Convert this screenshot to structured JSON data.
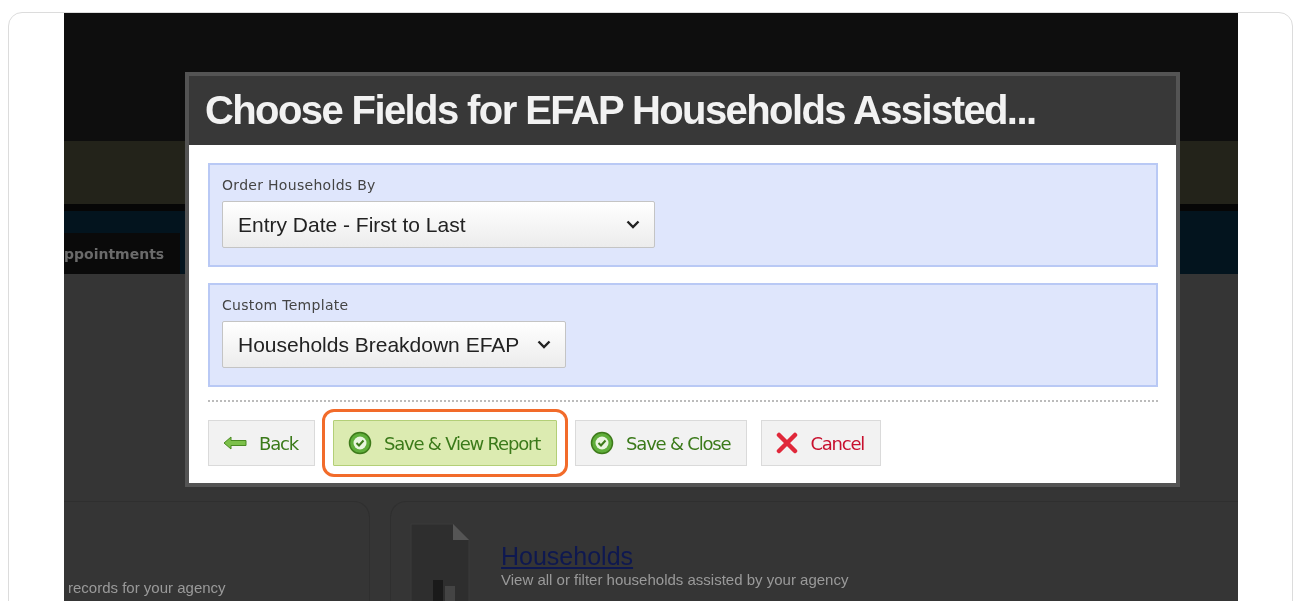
{
  "backdrop": {
    "nav_tab": "ppointments",
    "cards": [
      {
        "description": "records for your agency"
      },
      {
        "title": "Households",
        "description": "View all or filter households assisted by your agency"
      }
    ]
  },
  "dialog": {
    "title": "Choose Fields for EFAP Households Assisted...",
    "fields": [
      {
        "label": "Order Households By",
        "value": "Entry Date - First to Last"
      },
      {
        "label": "Custom Template",
        "value": "Households Breakdown EFAP"
      }
    ],
    "buttons": [
      {
        "label": "Back",
        "kind": "back",
        "highlighted": false
      },
      {
        "label": "Save & View Report",
        "kind": "save",
        "highlighted": true
      },
      {
        "label": "Save & Close",
        "kind": "save",
        "highlighted": false
      },
      {
        "label": "Cancel",
        "kind": "cancel",
        "highlighted": false
      }
    ]
  }
}
